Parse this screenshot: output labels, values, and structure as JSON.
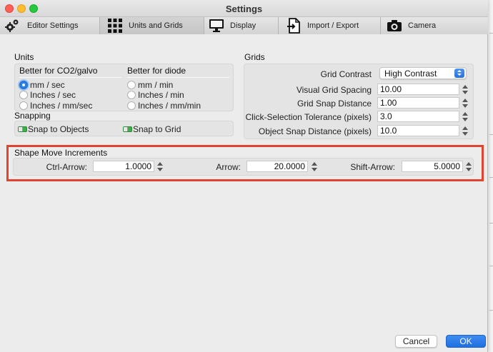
{
  "window": {
    "title": "Settings"
  },
  "tabs": [
    {
      "label": "Editor Settings",
      "icon": "gears-icon"
    },
    {
      "label": "Units and Grids",
      "icon": "grid-icon"
    },
    {
      "label": "Display",
      "icon": "monitor-icon"
    },
    {
      "label": "Import / Export",
      "icon": "import-export-icon"
    },
    {
      "label": "Camera",
      "icon": "camera-icon"
    }
  ],
  "units": {
    "title": "Units",
    "co2": {
      "heading": "Better for CO2/galvo",
      "options": [
        "mm / sec",
        "Inches / sec",
        "Inches / mm/sec"
      ],
      "selected": "mm / sec"
    },
    "diode": {
      "heading": "Better for diode",
      "options": [
        "mm / min",
        "Inches / min",
        "Inches / mm/min"
      ]
    }
  },
  "snapping": {
    "title": "Snapping",
    "snap_to_objects": "Snap to Objects",
    "snap_to_grid": "Snap to Grid"
  },
  "grids": {
    "title": "Grids",
    "contrast_label": "Grid Contrast",
    "contrast_value": "High Contrast",
    "visual_spacing_label": "Visual Grid Spacing",
    "visual_spacing_value": "10.00",
    "snap_distance_label": "Grid Snap Distance",
    "snap_distance_value": "1.00",
    "click_tolerance_label": "Click-Selection Tolerance (pixels)",
    "click_tolerance_value": "3.0",
    "object_snap_label": "Object Snap Distance (pixels)",
    "object_snap_value": "10.0"
  },
  "shape_move": {
    "title": "Shape Move Increments",
    "ctrl_arrow_label": "Ctrl-Arrow:",
    "ctrl_arrow_value": "1.0000",
    "arrow_label": "Arrow:",
    "arrow_value": "20.0000",
    "shift_arrow_label": "Shift-Arrow:",
    "shift_arrow_value": "5.0000"
  },
  "buttons": {
    "cancel": "Cancel",
    "ok": "OK"
  },
  "colors": {
    "accent": "#2a7ee8",
    "highlight_box": "#e0432f",
    "toggle_on": "#3bb04a"
  }
}
